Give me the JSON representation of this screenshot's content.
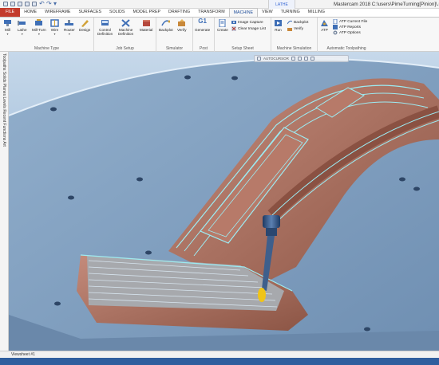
{
  "title_bar": {
    "quick_access_icons": [
      "file-new-icon",
      "open-icon",
      "save-icon",
      "save-as-icon",
      "print-icon",
      "undo-icon",
      "redo-icon",
      "customize-icon"
    ],
    "context_label": "LATHE",
    "app_title": "Mastercam 2018 C:\\users\\PimeTurning[Pinion]\\.mcam"
  },
  "tabs": [
    {
      "label": "FILE"
    },
    {
      "label": "HOME"
    },
    {
      "label": "WIREFRAME"
    },
    {
      "label": "SURFACES"
    },
    {
      "label": "SOLIDS"
    },
    {
      "label": "MODEL PREP"
    },
    {
      "label": "DRAFTING"
    },
    {
      "label": "TRANSFORM"
    },
    {
      "label": "MACHINE"
    },
    {
      "label": "VIEW"
    },
    {
      "label": "TURNING"
    },
    {
      "label": "MILLING"
    }
  ],
  "active_tab": "MACHINE",
  "ribbon": {
    "machine_type": {
      "label": "Machine Type",
      "buttons": [
        {
          "label": "Mill",
          "icon": "mill-icon"
        },
        {
          "label": "Lathe",
          "icon": "lathe-icon"
        },
        {
          "label": "Mill-Turn",
          "icon": "mill-turn-icon"
        },
        {
          "label": "Wire",
          "icon": "wire-icon"
        },
        {
          "label": "Router",
          "icon": "router-icon"
        },
        {
          "label": "Design",
          "icon": "design-icon"
        }
      ]
    },
    "job_setup": {
      "label": "Job Setup",
      "buttons": [
        {
          "label": "Control",
          "label2": "Definition",
          "icon": "control-definition-icon"
        },
        {
          "label": "Machine",
          "label2": "Definition",
          "icon": "machine-definition-icon"
        },
        {
          "label": "Material",
          "icon": "material-icon"
        }
      ]
    },
    "simulator": {
      "label": "Simulator",
      "buttons": [
        {
          "label": "Backplot",
          "icon": "backplot-icon"
        },
        {
          "label": "Verify",
          "icon": "verify-icon"
        }
      ]
    },
    "post": {
      "label": "Post",
      "buttons": [
        {
          "label": "Generate",
          "glyph": "G1",
          "icon": "g1-icon"
        }
      ]
    },
    "setup_sheet": {
      "label": "Setup Sheet",
      "buttons": [
        {
          "label": "Create",
          "icon": "create-setup-sheet-icon"
        }
      ],
      "small_buttons": [
        {
          "label": "Image Capture",
          "icon": "image-capture-icon"
        },
        {
          "label": "Clear Image List",
          "icon": "clear-image-list-icon"
        }
      ]
    },
    "machine_simulation": {
      "label": "Machine Simulation",
      "buttons": [
        {
          "label": "Run",
          "icon": "run-simulation-icon"
        }
      ],
      "small_buttons": [
        {
          "label": "Backplot",
          "icon": "backplot-small-icon"
        },
        {
          "label": "Verify",
          "icon": "verify-small-icon"
        }
      ]
    },
    "automatic_toolpathing": {
      "label": "Automatic Toolpathing",
      "buttons": [
        {
          "label": "ATP",
          "icon": "atp-icon"
        }
      ],
      "small_buttons": [
        {
          "label": "ATP Current File",
          "icon": "atp-current-file-icon"
        },
        {
          "label": "ATP Reports",
          "icon": "atp-reports-icon"
        },
        {
          "label": "ATP Options",
          "icon": "atp-options-icon"
        }
      ]
    }
  },
  "left_panel": {
    "vertical_text": "Toolpaths  Solids  Planes  Levels  Recent Functions  Art"
  },
  "viewport": {
    "minibar_text": "AUTOCURSOR",
    "colors": {
      "machine_base": "#7e9dbe",
      "part": "#a86f5f",
      "toolpath": "#8fe5ee",
      "tool_tip": "#f0c419",
      "tool_holder": "#2f4f7a"
    }
  },
  "sheet_tab": "Viewsheet #1",
  "status_bar_color": "#2f5e9e"
}
